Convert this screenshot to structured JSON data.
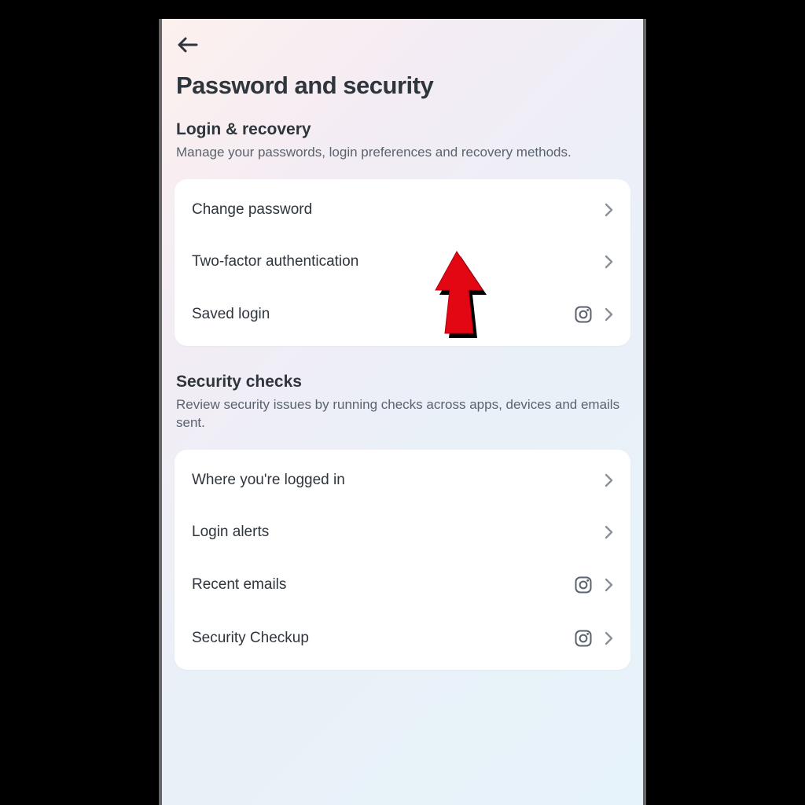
{
  "page": {
    "title": "Password and security"
  },
  "sections": {
    "login": {
      "title": "Login & recovery",
      "desc": "Manage your passwords, login preferences and recovery methods.",
      "items": [
        {
          "label": "Change password",
          "ig": false
        },
        {
          "label": "Two-factor authentication",
          "ig": false
        },
        {
          "label": "Saved login",
          "ig": true
        }
      ]
    },
    "security": {
      "title": "Security checks",
      "desc": "Review security issues by running checks across apps, devices and emails sent.",
      "items": [
        {
          "label": "Where you're logged in",
          "ig": false
        },
        {
          "label": "Login alerts",
          "ig": false
        },
        {
          "label": "Recent emails",
          "ig": true
        },
        {
          "label": "Security Checkup",
          "ig": true
        }
      ]
    }
  },
  "colors": {
    "text_primary": "#2f353c",
    "text_secondary": "#5a636d",
    "chevron": "#8a9199",
    "annotation": "#e30613"
  }
}
